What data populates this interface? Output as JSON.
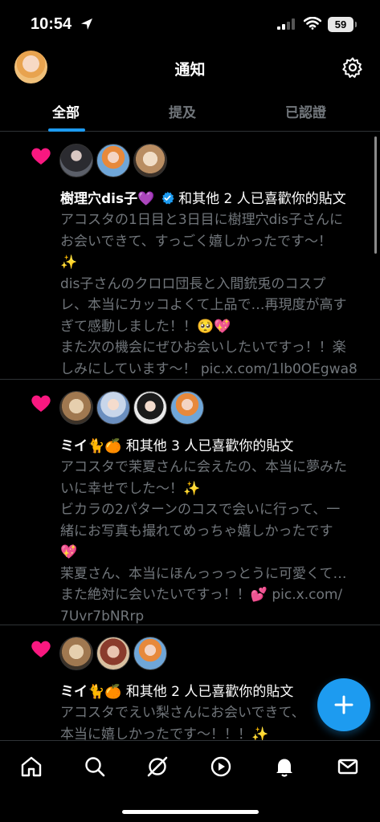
{
  "status_bar": {
    "time": "10:54",
    "battery": "59"
  },
  "header": {
    "title": "通知"
  },
  "tabs": [
    {
      "label": "全部",
      "active": true
    },
    {
      "label": "提及",
      "active": false
    },
    {
      "label": "已認證",
      "active": false
    }
  ],
  "notifications": [
    {
      "name": "樹理穴dis子💜",
      "verified": true,
      "action": " 和其他 2 人已喜歡你的貼文",
      "lines": [
        "アコスタの1日目と3日目に樹理穴dis子さんに",
        "お会いできて、すっごく嬉しかったです〜！",
        "✨",
        "dis子さんのクロロ団長と入間銃兎のコスプ",
        "レ、本当にカッコよくて上品で…再現度が高す",
        "ぎて感動しました！！🥺💖",
        "また次の機会にぜひお会いしたいですっ！！楽",
        "しみにしています〜！ pic.x.com/1lb0OEgwa8"
      ]
    },
    {
      "name": "ミイ🐈🍊",
      "verified": false,
      "action": " 和其他 3 人已喜歡你的貼文",
      "lines": [
        "アコスタで茉夏さんに会えたの、本当に夢みた",
        "いに幸せでした〜！✨",
        "ビカラの2パターンのコスで会いに行って、一",
        "緒にお写真も撮れてめっちゃ嬉しかったです",
        "💖",
        "茉夏さん、本当にほんっっっとうに可愛くて…",
        "また絶対に会いたいですっ！！💕 pic.x.com/",
        "7Uvr7bNRrp"
      ]
    },
    {
      "name": "ミイ🐈🍊",
      "verified": false,
      "action": " 和其他 2 人已喜歡你的貼文",
      "lines": [
        "アコスタでえい梨さんにお会いできて、",
        "本当に嬉しかったです〜！！！✨"
      ]
    }
  ],
  "colors": {
    "accent": "#1d9bf0",
    "heart": "#f91880",
    "muted": "#71767b"
  },
  "bottom_nav": [
    "home-icon",
    "search-icon",
    "grok-icon",
    "video-icon",
    "notifications-icon",
    "messages-icon"
  ]
}
